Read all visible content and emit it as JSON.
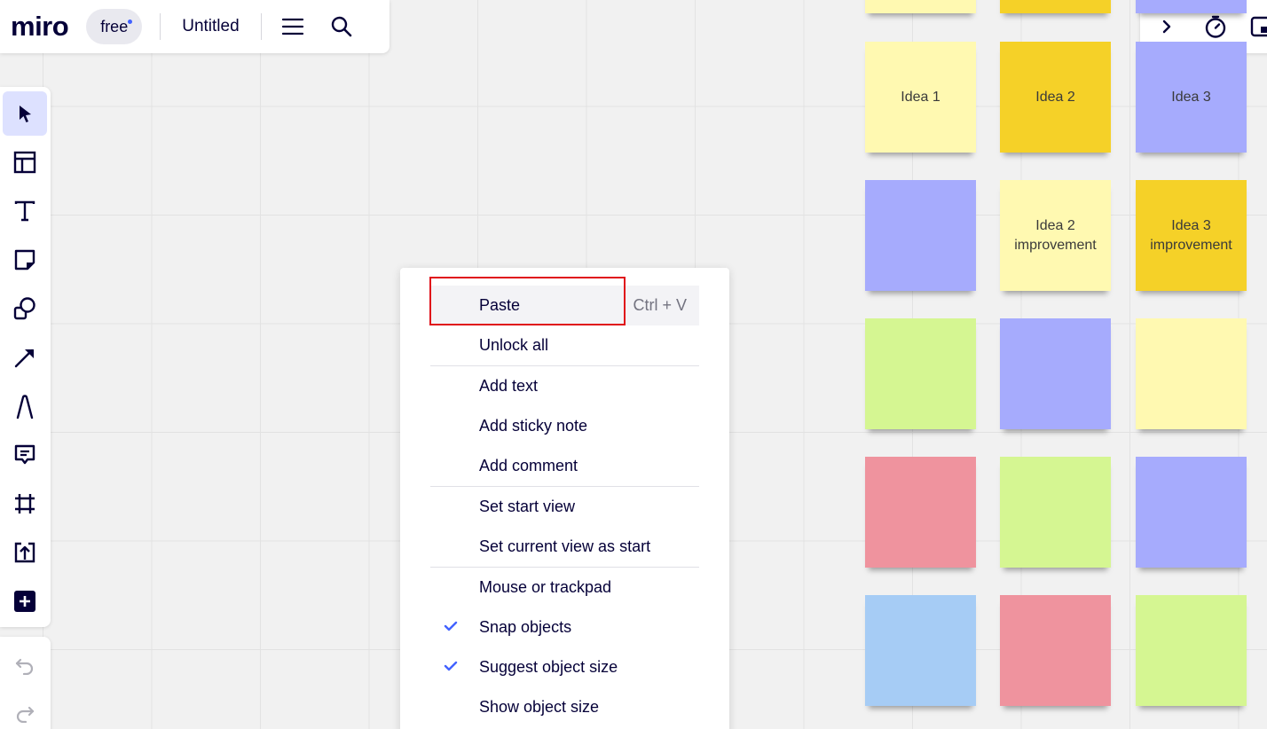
{
  "app": {
    "logo": "miro",
    "plan_badge": "free",
    "board_title": "Untitled",
    "accent_color": "#4262ff"
  },
  "topbar": {
    "icons": [
      "menu-icon",
      "search-icon"
    ]
  },
  "topright": {
    "icons": [
      "chevron-right-icon",
      "timer-icon",
      "panel-icon"
    ]
  },
  "toolbar": {
    "tools": [
      "select",
      "templates",
      "text",
      "sticky-note",
      "shapes",
      "connection-line",
      "pen",
      "comment",
      "frame",
      "upload",
      "more"
    ],
    "history": [
      "undo",
      "redo"
    ]
  },
  "stickies": [
    {
      "text": "",
      "color": "#fff9b1"
    },
    {
      "text": "",
      "color": "#f5d128"
    },
    {
      "text": "",
      "color": "#a6abfd"
    },
    {
      "text": "Idea 1",
      "color": "#fff9b1"
    },
    {
      "text": "Idea 2",
      "color": "#f5d128"
    },
    {
      "text": "Idea 3",
      "color": "#a6abfd"
    },
    {
      "text": "",
      "color": "#a6abfd"
    },
    {
      "text": "Idea 2 improvement",
      "color": "#fff9b1"
    },
    {
      "text": "Idea 3 improvement",
      "color": "#f5d128"
    },
    {
      "text": "",
      "color": "#d5f692"
    },
    {
      "text": "",
      "color": "#a6abfd"
    },
    {
      "text": "",
      "color": "#fff9b1"
    },
    {
      "text": "",
      "color": "#ef939e"
    },
    {
      "text": "",
      "color": "#d5f692"
    },
    {
      "text": "",
      "color": "#a6abfd"
    },
    {
      "text": "",
      "color": "#a6ccf5"
    },
    {
      "text": "",
      "color": "#ef939e"
    },
    {
      "text": "",
      "color": "#d5f692"
    }
  ],
  "context_menu": {
    "paste": {
      "label": "Paste",
      "shortcut": "Ctrl + V"
    },
    "unlock_all": "Unlock all",
    "add_text": "Add text",
    "add_sticky_note": "Add sticky note",
    "add_comment": "Add comment",
    "set_start_view": "Set start view",
    "set_current_view_as_start": "Set current view as start",
    "mouse_or_trackpad": "Mouse or trackpad",
    "snap_objects": {
      "label": "Snap objects",
      "checked": true
    },
    "suggest_object_size": {
      "label": "Suggest object size",
      "checked": true
    },
    "show_object_size": {
      "label": "Show object size",
      "checked": false
    },
    "highlight_color": "#e0101a"
  }
}
